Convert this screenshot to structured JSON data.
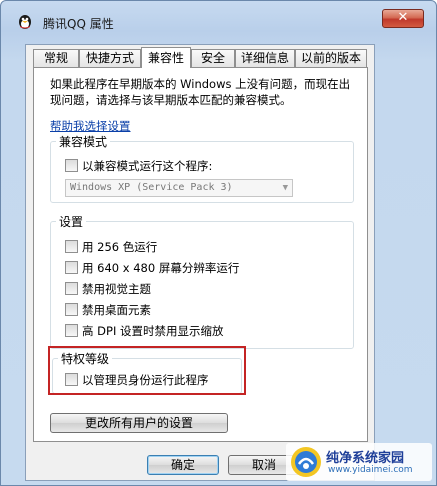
{
  "window": {
    "title": "腾讯QQ 属性",
    "close_label": "✕"
  },
  "tabs": [
    {
      "label": "常规"
    },
    {
      "label": "快捷方式"
    },
    {
      "label": "兼容性"
    },
    {
      "label": "安全"
    },
    {
      "label": "详细信息"
    },
    {
      "label": "以前的版本"
    }
  ],
  "active_tab": "兼容性",
  "intro": {
    "line1": "如果此程序在早期版本的 Windows 上没有问题，而现在出",
    "line2": "现问题，请选择与该早期版本匹配的兼容模式。"
  },
  "help_link": "帮助我选择设置",
  "compat_mode": {
    "title": "兼容模式",
    "checkbox_label": "以兼容模式运行这个程序:",
    "os_select_value": "Windows XP (Service Pack 3)"
  },
  "settings": {
    "title": "设置",
    "options": [
      {
        "label": "用 256 色运行"
      },
      {
        "label": "用 640 x 480 屏幕分辨率运行"
      },
      {
        "label": "禁用视觉主题"
      },
      {
        "label": "禁用桌面元素"
      },
      {
        "label": "高 DPI 设置时禁用显示缩放"
      }
    ]
  },
  "privilege": {
    "title": "特权等级",
    "checkbox_label": "以管理员身份运行此程序"
  },
  "buttons": {
    "change_all_users": "更改所有用户的设置",
    "ok": "确定",
    "cancel": "取消"
  },
  "watermark": {
    "title": "纯净系统家园",
    "url": "www.yidaimei.com"
  },
  "colors": {
    "highlight_outline": "#c42424",
    "link": "#0a3fa8"
  }
}
